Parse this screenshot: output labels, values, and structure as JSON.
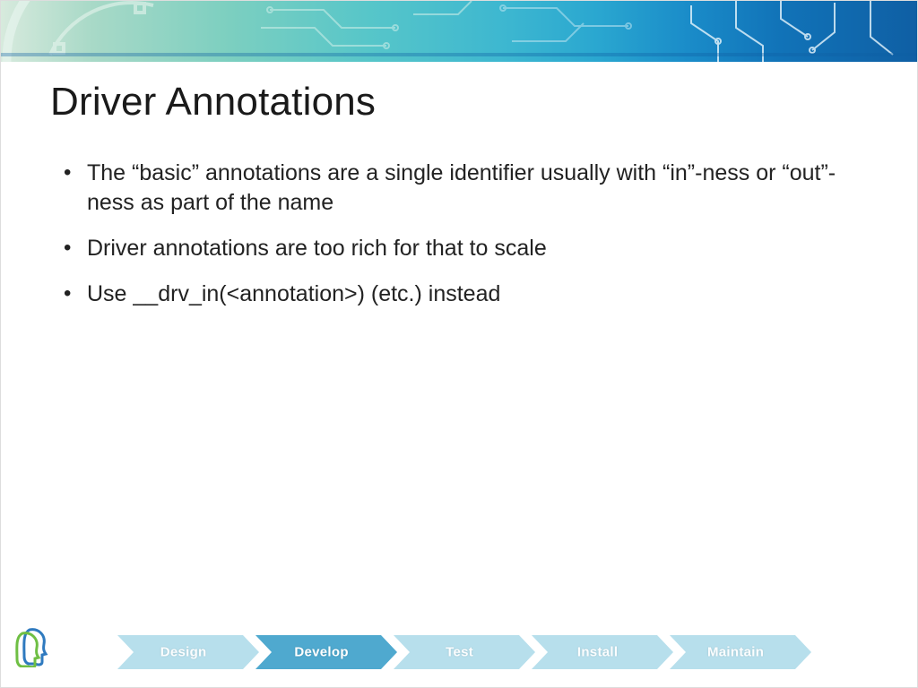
{
  "title": "Driver Annotations",
  "bullets": [
    "The “basic” annotations are a single identifier usually with “in”-ness or “out”-ness as part of the name",
    "Driver annotations are too rich for that to scale",
    "Use __drv_in(<annotation>) (etc.) instead"
  ],
  "footer": {
    "steps": [
      {
        "label": "Design",
        "emphasis": false
      },
      {
        "label": "Develop",
        "emphasis": true
      },
      {
        "label": "Test",
        "emphasis": false
      },
      {
        "label": "Install",
        "emphasis": false
      },
      {
        "label": "Maintain",
        "emphasis": false
      }
    ]
  },
  "colors": {
    "arrow_light": "#b7dfec",
    "arrow_dark": "#4fa9cf"
  }
}
